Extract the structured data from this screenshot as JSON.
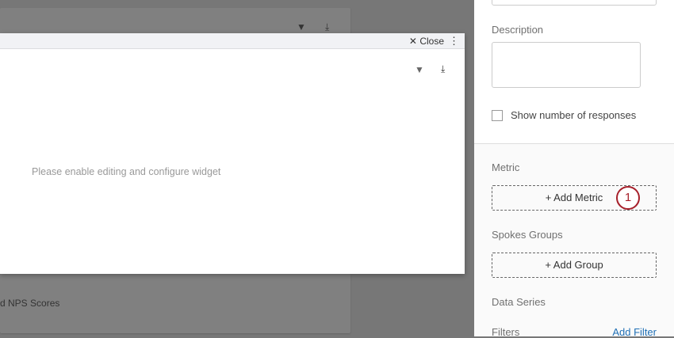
{
  "background": {
    "card_text": "d NPS Scores"
  },
  "modal": {
    "close_label": "Close",
    "kebab": "⋮",
    "placeholder": "Please enable editing and configure widget"
  },
  "panel": {
    "description_label": "Description",
    "show_responses_label": "Show number of responses",
    "metric_label": "Metric",
    "add_metric_label": "+ Add Metric",
    "annotation_number": "1",
    "spokes_label": "Spokes Groups",
    "add_group_label": "+ Add Group",
    "data_series_label": "Data Series",
    "filters_label": "Filters",
    "add_filter_label": "Add Filter"
  },
  "colors": {
    "accent": "#1f6fb5",
    "annotation": "#a61f2a"
  }
}
